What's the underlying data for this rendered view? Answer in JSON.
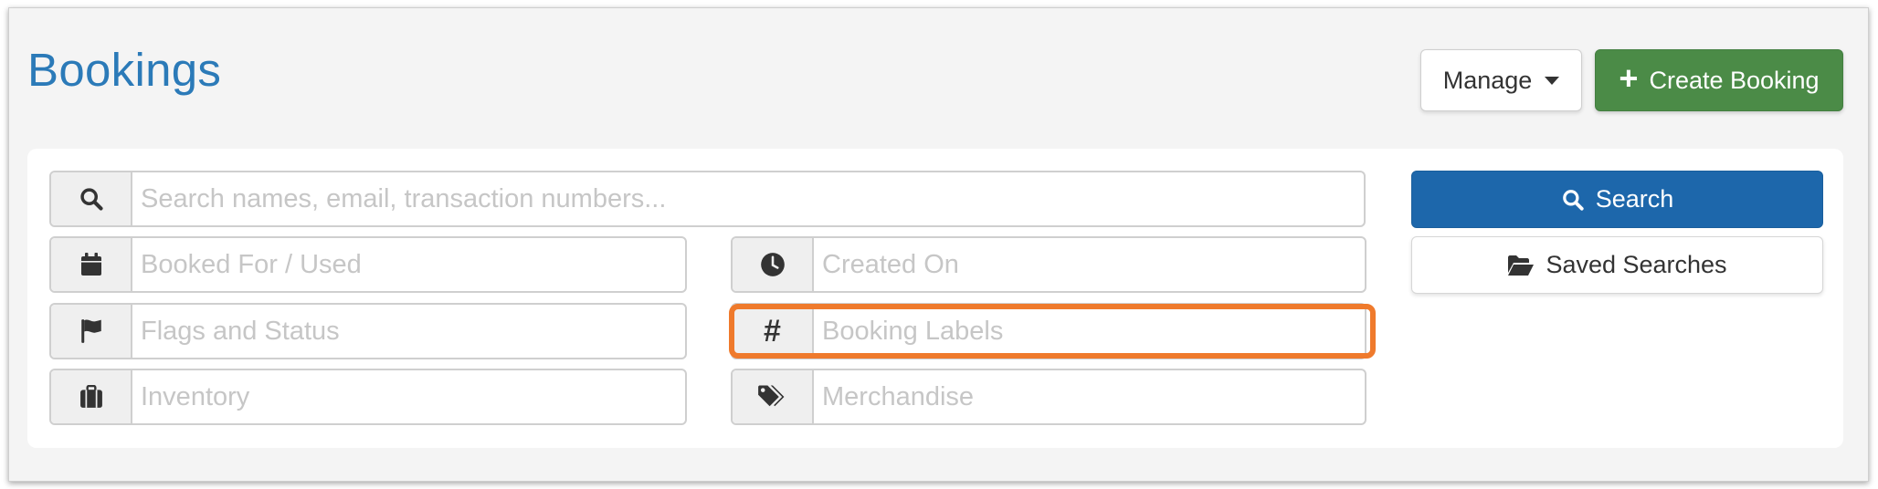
{
  "header": {
    "title": "Bookings"
  },
  "toolbar": {
    "manage_label": "Manage",
    "create_label": "Create Booking",
    "create_color": "#4b8b47"
  },
  "search": {
    "main_placeholder": "Search names, email, transaction numbers...",
    "search_label": "Search",
    "search_color": "#1d67ab",
    "saved_label": "Saved Searches"
  },
  "filters": {
    "booked_for": {
      "placeholder": "Booked For / Used",
      "icon": "calendar-icon"
    },
    "created_on": {
      "placeholder": "Created On",
      "icon": "clock-icon"
    },
    "flags": {
      "placeholder": "Flags and Status",
      "icon": "flag-icon"
    },
    "labels": {
      "placeholder": "Booking Labels",
      "icon": "hash-icon"
    },
    "inventory": {
      "placeholder": "Inventory",
      "icon": "briefcase-icon"
    },
    "merchandise": {
      "placeholder": "Merchandise",
      "icon": "tags-icon"
    }
  },
  "highlight_color": "#ef7a2c"
}
